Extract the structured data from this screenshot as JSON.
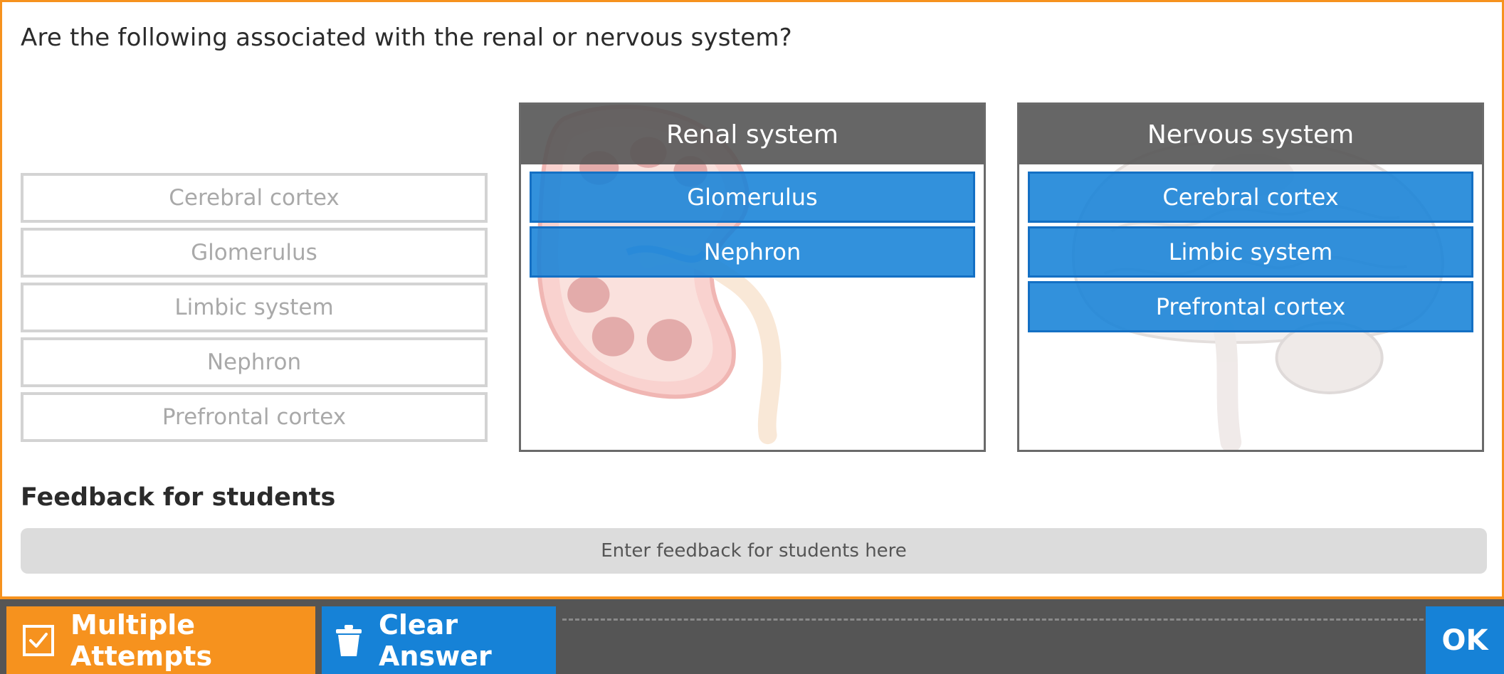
{
  "question": "Are the following associated with the renal or nervous system?",
  "source_items": [
    {
      "label": "Cerebral cortex"
    },
    {
      "label": "Glomerulus"
    },
    {
      "label": "Limbic system"
    },
    {
      "label": "Nephron"
    },
    {
      "label": "Prefrontal cortex"
    }
  ],
  "categories": {
    "renal": {
      "title": "Renal system",
      "background_icon": "kidney-illustration",
      "items": [
        "Glomerulus",
        "Nephron"
      ]
    },
    "nervous": {
      "title": "Nervous system",
      "background_icon": "brain-illustration",
      "items": [
        "Cerebral cortex",
        "Limbic system",
        "Prefrontal cortex"
      ]
    }
  },
  "feedback": {
    "heading": "Feedback for students",
    "placeholder": "Enter feedback for students here"
  },
  "toolbar": {
    "multiple_attempts_label": "Multiple Attempts",
    "multiple_attempts_icon": "checkbox-checked-icon",
    "clear_answer_label": "Clear Answer",
    "clear_answer_icon": "trash-icon",
    "ok_label": "OK"
  },
  "colors": {
    "frame_border": "#f6921e",
    "answer_blue": "#1682d7",
    "header_gray": "#555555",
    "toolbar_bg": "#555555"
  }
}
